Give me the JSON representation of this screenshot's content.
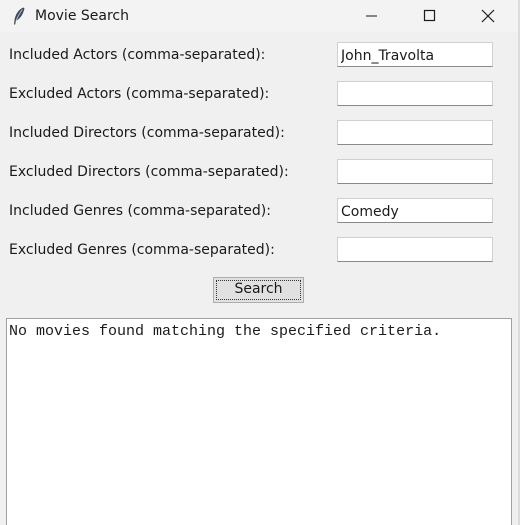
{
  "window": {
    "title": "Movie Search",
    "app_icon": "feather-icon",
    "controls": {
      "minimize_icon": "minimize-icon",
      "maximize_icon": "maximize-icon",
      "close_icon": "close-icon"
    }
  },
  "form": {
    "fields": [
      {
        "label": "Included Actors (comma-separated):",
        "value": "John_Travolta"
      },
      {
        "label": "Excluded Actors (comma-separated):",
        "value": ""
      },
      {
        "label": "Included Directors (comma-separated):",
        "value": ""
      },
      {
        "label": "Excluded Directors (comma-separated):",
        "value": ""
      },
      {
        "label": "Included Genres (comma-separated):",
        "value": "Comedy"
      },
      {
        "label": "Excluded Genres (comma-separated):",
        "value": ""
      }
    ],
    "search_label": "Search"
  },
  "output": {
    "text": "No movies found matching the specified criteria."
  },
  "colors": {
    "window_bg": "#f0f0f0",
    "entry_bg": "#ffffff",
    "button_bg": "#e1e1e1"
  }
}
